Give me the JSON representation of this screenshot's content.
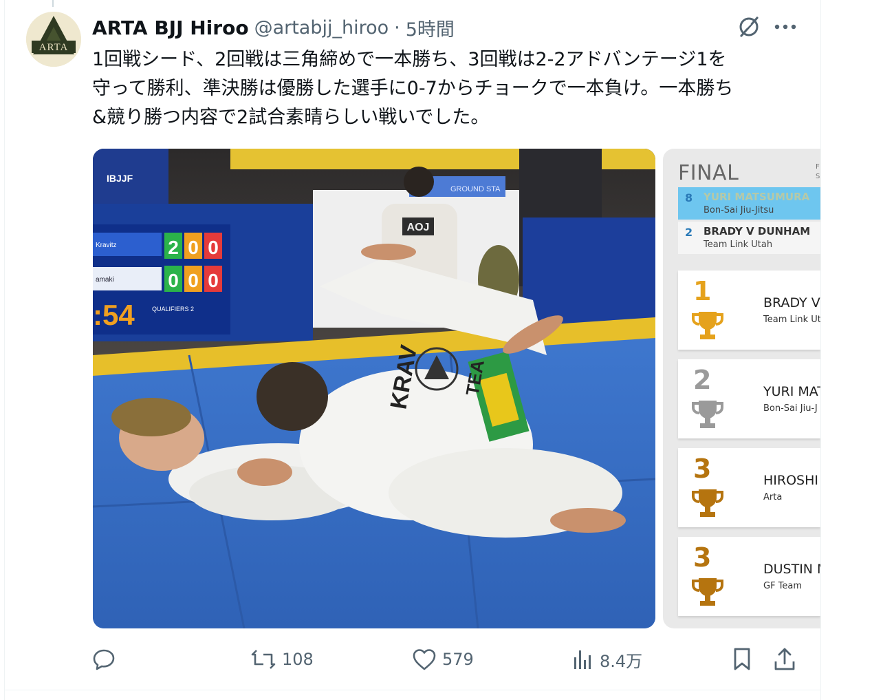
{
  "tweet": {
    "display_name": "ARTA BJJ Hiroo",
    "handle": "@artabjj_hiroo",
    "separator": "·",
    "time": "5時間",
    "text": "1回戦シード、2回戦は三角締めで一本勝ち、3回戦は2-2アドバンテージ1を\n守って勝利、準決勝は優勝した選手に0-7からチョークで一本負け。一本勝ち\n&競り勝つ内容で2試合素晴らしい戦いでした。",
    "avatar_text": "ARTA"
  },
  "scoreboard": {
    "score_top": [
      "2",
      "0",
      "0"
    ],
    "score_bottom": [
      "0",
      "0",
      "0"
    ],
    "name_top": "Kravitz",
    "name_bottom": "amaki",
    "clock": ":54",
    "label": "QUALIFIERS 2",
    "logo": "IBJJF"
  },
  "photo_text": {
    "gi_text": "KRAV",
    "gi_text_2": "TEA",
    "back_patch": "AOJ",
    "banner": "GROUND STA"
  },
  "bracket": {
    "title": "FINAL",
    "corner": [
      "F",
      "S"
    ],
    "match": [
      {
        "seed": "8",
        "name": "YURI MATSUMURA",
        "team": "Bon-Sai Jiu-Jitsu"
      },
      {
        "seed": "2",
        "name": "BRADY V DUNHAM",
        "team": "Team Link Utah"
      }
    ],
    "podium": [
      {
        "place": "1",
        "name": "BRADY V",
        "team": "Team Link Ut",
        "color": "#e5a21c"
      },
      {
        "place": "2",
        "name": "YURI MAT",
        "team": "Bon-Sai Jiu-J",
        "color": "#9a9a9a"
      },
      {
        "place": "3",
        "name": "HIROSHI",
        "team": "Arta",
        "color": "#b5740f"
      },
      {
        "place": "3",
        "name": "DUSTIN M",
        "team": "GF Team",
        "color": "#b5740f"
      }
    ]
  },
  "actions": {
    "reply_count": "",
    "retweet_count": "108",
    "like_count": "579",
    "views_count": "8.4万"
  }
}
